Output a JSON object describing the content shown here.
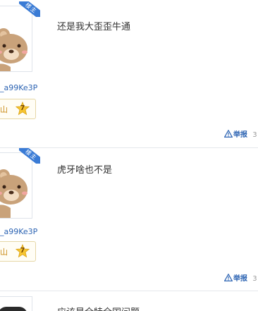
{
  "posts": [
    {
      "badge": "楼主",
      "username": "_a99Ke3P",
      "level_name": "山",
      "level_num": "7",
      "content": "还是我大歪歪牛通",
      "report_label": "举报",
      "more_label": "3"
    },
    {
      "badge": "楼主",
      "username": "_a99Ke3P",
      "level_name": "山",
      "level_num": "7",
      "content": "虎牙啥也不是",
      "report_label": "举报",
      "more_label": "3"
    },
    {
      "content": "应该是全特全国问题"
    }
  ],
  "colors": {
    "link": "#2d64b3",
    "badge": "#3a7bd5",
    "level": "#c98a16",
    "star": "#f7c531"
  },
  "icons": {
    "report": "warning-triangle-icon",
    "level": "star-badge-icon",
    "avatar": "bear-avatar"
  }
}
